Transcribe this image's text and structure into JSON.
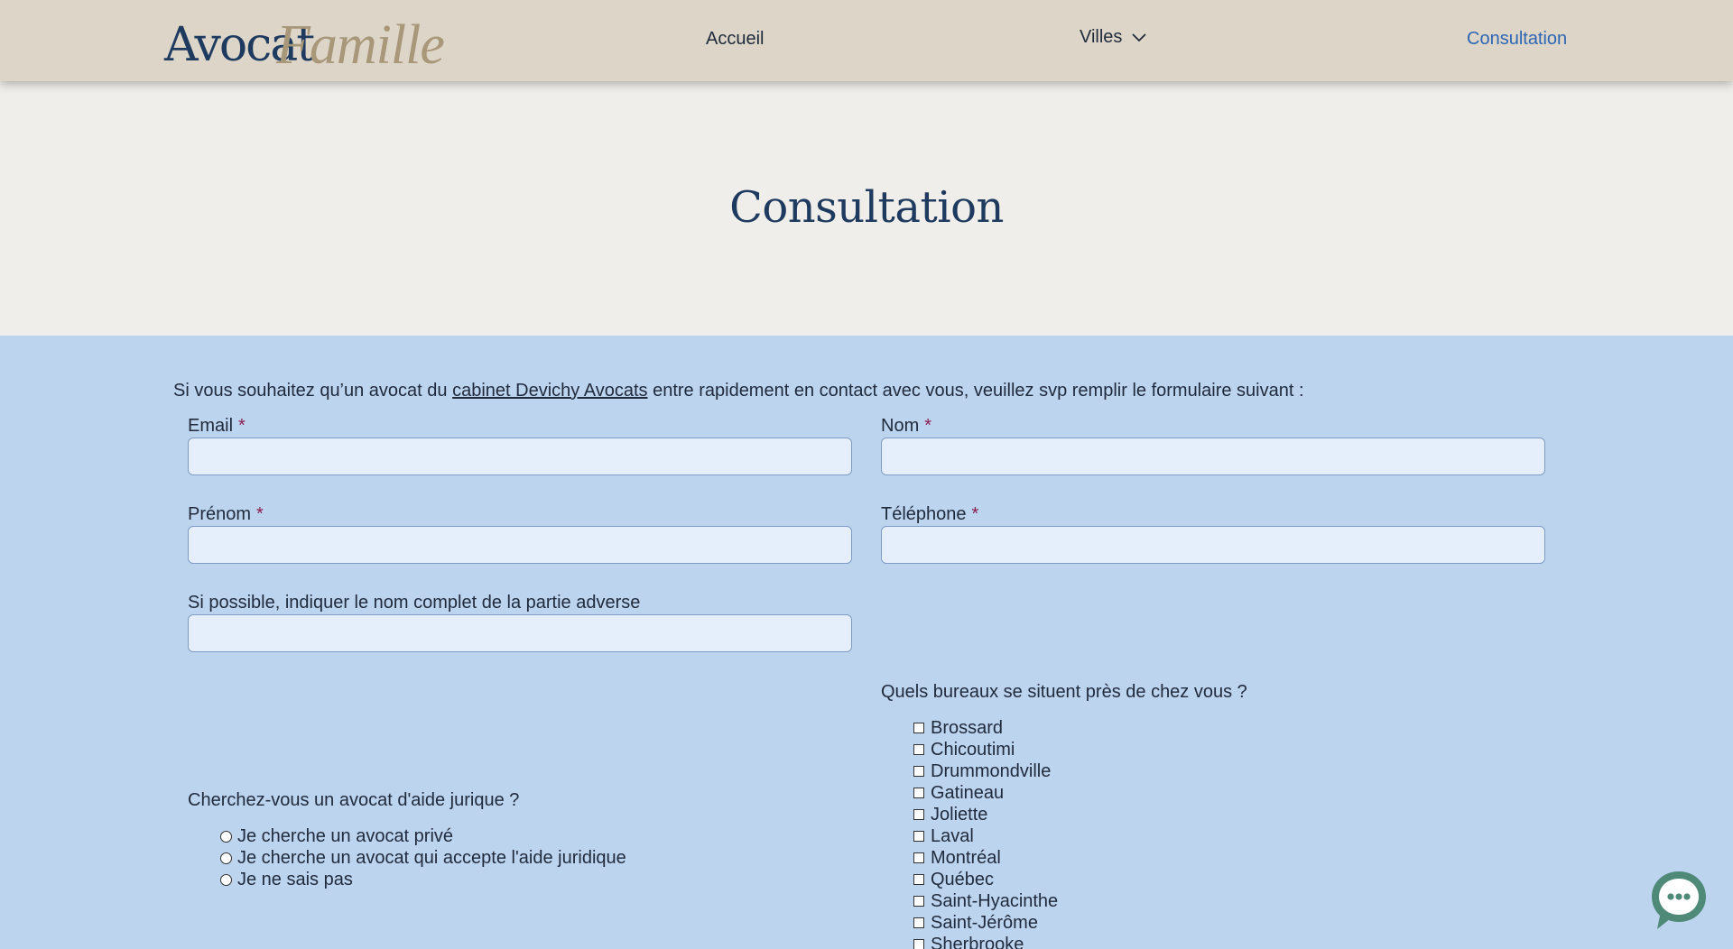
{
  "header": {
    "logo_main": "Avocat",
    "logo_script": "Famille",
    "nav": {
      "accueil": "Accueil",
      "villes": "Villes",
      "consultation": "Consultation"
    }
  },
  "hero": {
    "title": "Consultation"
  },
  "form": {
    "intro_before": "Si vous souhaitez qu’un avocat du ",
    "intro_link": "cabinet Devichy Avocats",
    "intro_after": " entre rapidement en contact avec vous, veuillez svp remplir le formulaire suivant :",
    "required_mark": "*",
    "email_label": "Email",
    "nom_label": "Nom",
    "prenom_label": "Prénom",
    "telephone_label": "Téléphone",
    "adverse_label": "Si possible, indiquer le nom complet de la partie adverse",
    "bureaux_label": "Quels bureaux se situent près de chez vous ?",
    "bureaux": [
      "Brossard",
      "Chicoutimi",
      "Drummondville",
      "Gatineau",
      "Joliette",
      "Laval",
      "Montréal",
      "Québec",
      "Saint-Hyacinthe",
      "Saint-Jérôme",
      "Sherbrooke"
    ],
    "aide_label": "Cherchez-vous un avocat d'aide jurique ?",
    "aide_options": [
      "Je cherche un avocat privé",
      "Je cherche un avocat qui accepte l'aide juridique",
      "Je ne sais pas"
    ]
  },
  "colors": {
    "navy": "#1f3a5f",
    "gold": "#a89779",
    "accent_link": "#2d66b4",
    "required": "#8a1f4d",
    "section_bg": "#bdd4ef",
    "chat_bubble": "#4f8a78"
  },
  "icons": {
    "villes_dropdown": "chevron-down-icon",
    "chat": "chat-bubble-icon"
  }
}
